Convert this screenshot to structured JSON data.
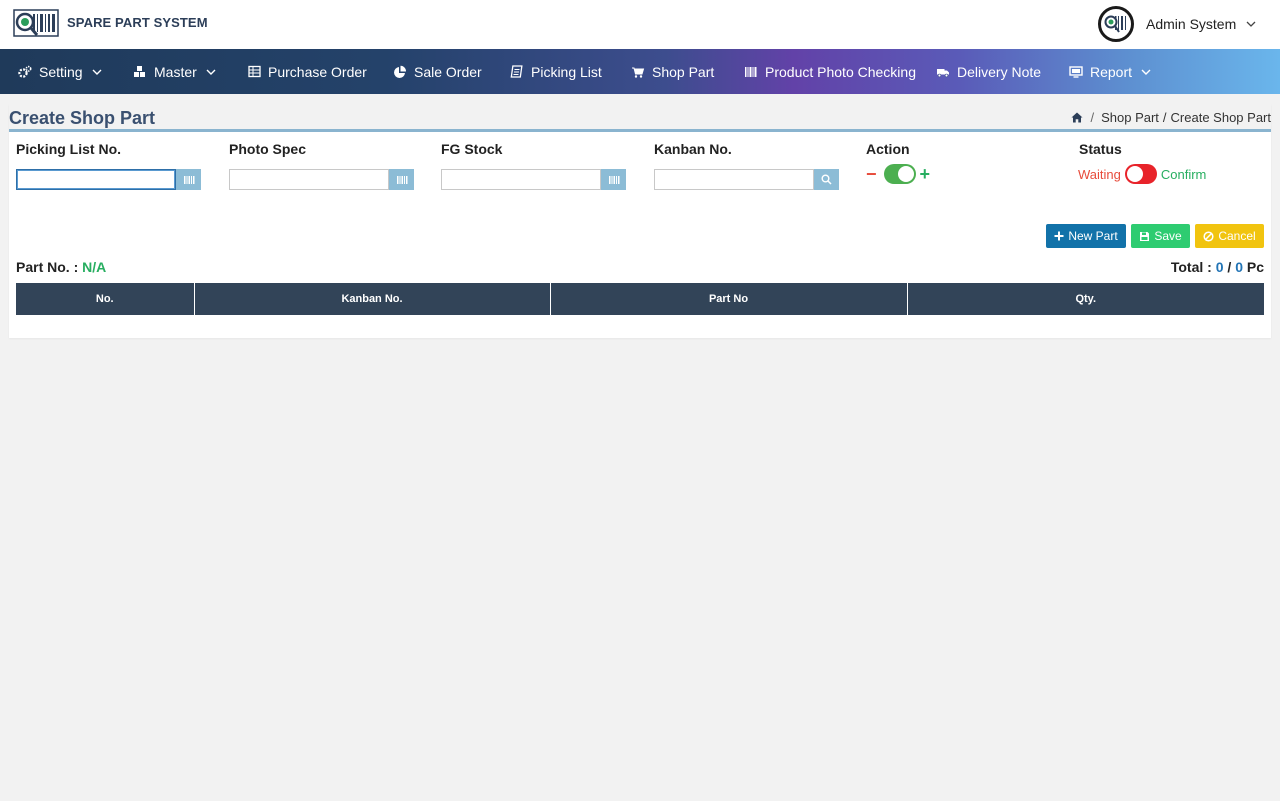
{
  "app": {
    "brand": "SPARE PART SYSTEM"
  },
  "user": {
    "name": "Admin System"
  },
  "nav": {
    "setting": "Setting",
    "master": "Master",
    "purchase_order": "Purchase Order",
    "sale_order": "Sale Order",
    "picking_list": "Picking List",
    "shop_part": "Shop Part",
    "product_photo_checking": "Product Photo Checking",
    "delivery_note": "Delivery Note",
    "report": "Report"
  },
  "page": {
    "title": "Create Shop Part",
    "breadcrumb": {
      "parent": "Shop Part",
      "separator": "/",
      "current": "Create Shop Part",
      "sep2": "/"
    }
  },
  "form": {
    "picking_list_label": "Picking List No.",
    "picking_list_value": "",
    "photo_spec_label": "Photo Spec",
    "photo_spec_value": "",
    "fg_stock_label": "FG Stock",
    "fg_stock_value": "",
    "kanban_label": "Kanban No.",
    "kanban_value": "",
    "action_label": "Action",
    "action_minus": "−",
    "action_plus": "+",
    "action_state": "plus",
    "status_label": "Status",
    "status_waiting": "Waiting",
    "status_confirm": "Confirm",
    "status_state": "waiting"
  },
  "buttons": {
    "new_part": "New Part",
    "save": "Save",
    "cancel": "Cancel"
  },
  "summary": {
    "part_no_label": "Part No. :",
    "part_no_value": "N/A",
    "total_label": "Total :",
    "total_done": "0",
    "total_sep": "/",
    "total_all": "0",
    "total_unit": "Pc"
  },
  "table": {
    "columns": [
      "No.",
      "Kanban No.",
      "Part No",
      "Qty."
    ],
    "rows": []
  },
  "colors": {
    "accent": "#1272a9",
    "success": "#2ecc71",
    "warning": "#f1c40f",
    "danger": "#e74c3c",
    "table_header": "#324458"
  },
  "icons": {
    "setting": "gears-icon",
    "master": "cubes-icon",
    "purchase_order": "table-icon",
    "sale_order": "pie-chart-icon",
    "picking_list": "list-icon",
    "shop_part": "cart-icon",
    "product_photo_checking": "barcode-icon",
    "delivery_note": "truck-icon",
    "report": "monitor-icon"
  }
}
